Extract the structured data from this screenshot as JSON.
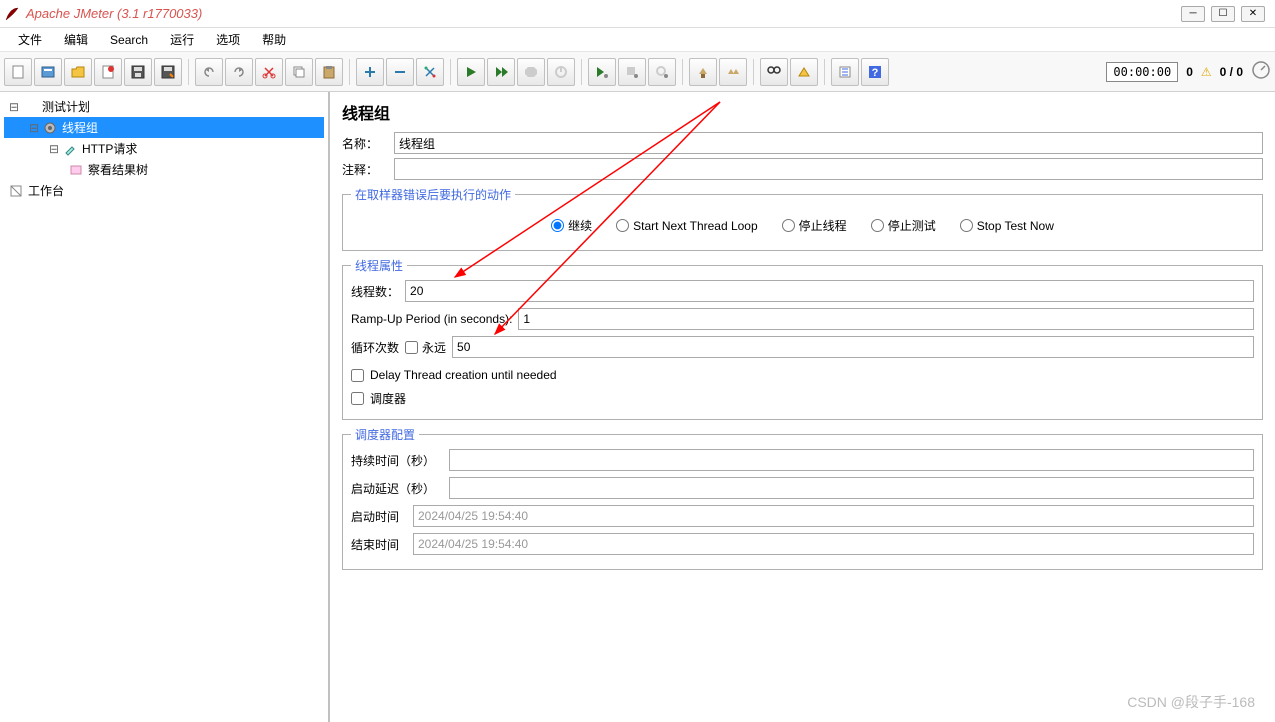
{
  "window": {
    "title": "Apache JMeter (3.1 r1770033)"
  },
  "menu": {
    "file": "文件",
    "edit": "编辑",
    "search": "Search",
    "run": "运行",
    "options": "选项",
    "help": "帮助"
  },
  "status": {
    "timer": "00:00:00",
    "active": "0",
    "total": "0 / 0"
  },
  "tree": {
    "test_plan": "测试计划",
    "thread_group": "线程组",
    "http_request": "HTTP请求",
    "view_results_tree": "察看结果树",
    "workbench": "工作台"
  },
  "panel": {
    "title": "线程组",
    "name_label": "名称：",
    "name_value": "线程组",
    "comment_label": "注释：",
    "comment_value": "",
    "error_action": {
      "legend": "在取样器错误后要执行的动作",
      "opt_continue": "继续",
      "opt_next_loop": "Start Next Thread Loop",
      "opt_stop_thread": "停止线程",
      "opt_stop_test": "停止测试",
      "opt_stop_now": "Stop Test Now"
    },
    "thread_props": {
      "legend": "线程属性",
      "threads_label": "线程数：",
      "threads_value": "20",
      "rampup_label": "Ramp-Up Period (in seconds):",
      "rampup_value": "1",
      "loop_label": "循环次数",
      "forever_label": "永远",
      "loop_value": "50",
      "delay_create_label": "Delay Thread creation until needed",
      "scheduler_label": "调度器"
    },
    "scheduler": {
      "legend": "调度器配置",
      "duration_label": "持续时间（秒）",
      "delay_label": "启动延迟（秒）",
      "start_label": "启动时间",
      "start_value": "2024/04/25 19:54:40",
      "end_label": "结束时间",
      "end_value": "2024/04/25 19:54:40"
    }
  },
  "watermark": "CSDN @段子手-168"
}
